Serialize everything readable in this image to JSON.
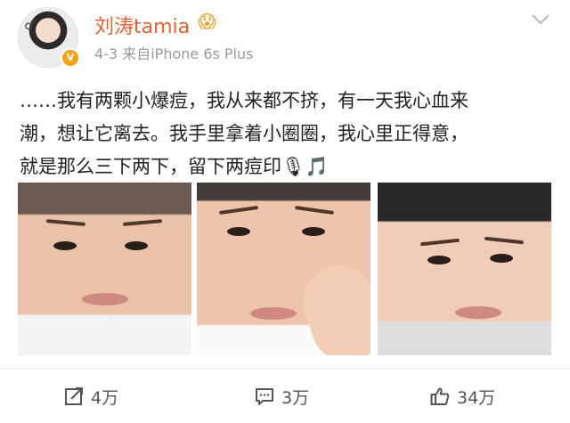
{
  "post": {
    "author": "刘涛tamia",
    "date": "4-3",
    "source": "来自iPhone 6s Plus",
    "text_lines": [
      "……我有两颗小爆痘，我从来都不挤，有一天我心血来",
      "潮，想让它离去。我手里拿着小圈圈，我心里正得意，",
      "就是那么三下两下，留下两痘印🎙🎵"
    ],
    "emoji_after_name": "😱",
    "verified_badge": "V"
  },
  "actions": {
    "repost_count": "4万",
    "comment_count": "3万",
    "like_count": "34万"
  },
  "icons": {
    "chevron": "chevron-down-icon",
    "repost": "repost-icon",
    "comment": "comment-icon",
    "like": "thumbs-up-icon"
  }
}
